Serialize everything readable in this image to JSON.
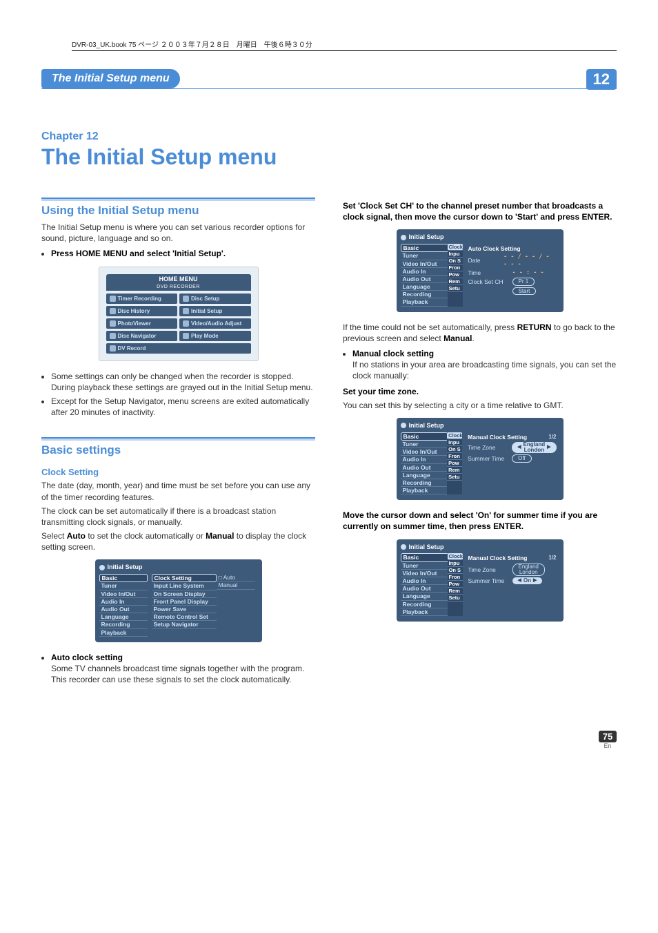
{
  "crop_header": "DVR-03_UK.book 75 ページ ２００３年７月２８日　月曜日　午後６時３０分",
  "header": {
    "title": "The Initial Setup menu",
    "chapter_num": "12"
  },
  "chapter": {
    "label": "Chapter 12",
    "title": "The Initial Setup menu"
  },
  "left": {
    "sec1": {
      "head": "Using the Initial Setup menu",
      "p1": "The Initial Setup menu is where you can set various recorder options for sound, picture, language and so on.",
      "b1": "Press HOME MENU and select 'Initial Setup'.",
      "b2": "Some settings can only be changed when the recorder is stopped. During playback these settings are grayed out in the Initial Setup menu.",
      "b3": "Except for the Setup Navigator, menu screens are exited automatically after 20 minutes of inactivity."
    },
    "home_menu": {
      "title": "HOME MENU",
      "subtitle": "DVD RECORDER",
      "tiles": [
        "Timer Recording",
        "Disc Setup",
        "Disc History",
        "Initial Setup",
        "PhotoViewer",
        "Video/Audio Adjust",
        "Disc Navigator",
        "Play Mode",
        "DV Record"
      ]
    },
    "sec2": {
      "head": "Basic settings",
      "sub": "Clock Setting",
      "p1": "The date (day, month, year) and time must be set before you can use any of the timer recording features.",
      "p2": "The clock can be set automatically if there is a broadcast station transmitting clock signals, or manually.",
      "p3a": "Select ",
      "p3b": "Auto",
      "p3c": " to set the clock automatically or ",
      "p3d": "Manual",
      "p3e": " to display the clock setting screen."
    },
    "osd1": {
      "title": "Initial Setup",
      "left": [
        "Basic",
        "Tuner",
        "Video In/Out",
        "Audio In",
        "Audio Out",
        "Language",
        "Recording",
        "Playback"
      ],
      "mid_sel": "Clock Setting",
      "mid": [
        "Input Line System",
        "On Screen Display",
        "Front Panel Display",
        "Power Save",
        "Remote Control Set",
        "Setup Navigator"
      ],
      "opts": [
        "Auto",
        "Manual"
      ]
    },
    "auto": {
      "head": "Auto clock setting",
      "p": "Some TV channels broadcast time signals together with the program. This recorder can use these signals to set the clock automatically."
    }
  },
  "right": {
    "lead": "Set 'Clock Set CH' to the channel preset number that broadcasts a clock signal, then move the cursor down to 'Start' and press ENTER.",
    "osd2": {
      "title": "Initial Setup",
      "left": [
        "Basic",
        "Tuner",
        "Video In/Out",
        "Audio In",
        "Audio Out",
        "Language",
        "Recording",
        "Playback"
      ],
      "stub": [
        "Clock",
        "Inpu",
        "On S",
        "Fron",
        "Pow",
        "Rem",
        "Setu"
      ],
      "hdr": "Auto Clock Setting",
      "date_lbl": "Date",
      "date_val": "- - / - - / - - - -",
      "time_lbl": "Time",
      "time_val": "- - : - -",
      "ch_lbl": "Clock Set CH",
      "ch_val": "Pr 1",
      "start": "Start"
    },
    "p2a": "If the time could not be set automatically, press ",
    "p2b": "RETURN",
    "p2c": " to go back to the previous screen and select ",
    "p2d": "Manual",
    "p2e": ".",
    "mcs_head": "Manual clock setting",
    "mcs_p": "If no stations in your area are broadcasting time signals, you can set the clock manually:",
    "tz_head": "Set your time zone.",
    "tz_p": "You can set this by selecting a city or a time relative to GMT.",
    "osd3": {
      "title": "Initial Setup",
      "left": [
        "Basic",
        "Tuner",
        "Video In/Out",
        "Audio In",
        "Audio Out",
        "Language",
        "Recording",
        "Playback"
      ],
      "stub": [
        "Clock",
        "Inpu",
        "On S",
        "Fron",
        "Pow",
        "Rem",
        "Setu"
      ],
      "hdr": "Manual Clock Setting",
      "page": "1/2",
      "tz_lbl": "Time Zone",
      "tz_val": "England\nLondon",
      "sum_lbl": "Summer Time",
      "sum_val": "Off"
    },
    "move": "Move the cursor down and select 'On' for summer time if you are currently on summer time, then press ENTER.",
    "osd4": {
      "title": "Initial Setup",
      "left": [
        "Basic",
        "Tuner",
        "Video In/Out",
        "Audio In",
        "Audio Out",
        "Language",
        "Recording",
        "Playback"
      ],
      "stub": [
        "Clock",
        "Inpu",
        "On S",
        "Fron",
        "Pow",
        "Rem",
        "Setu"
      ],
      "hdr": "Manual Clock Setting",
      "page": "1/2",
      "tz_lbl": "Time Zone",
      "tz_val": "England\nLondon",
      "sum_lbl": "Summer Time",
      "sum_val": "On"
    }
  },
  "footer": {
    "page": "75",
    "lang": "En"
  }
}
